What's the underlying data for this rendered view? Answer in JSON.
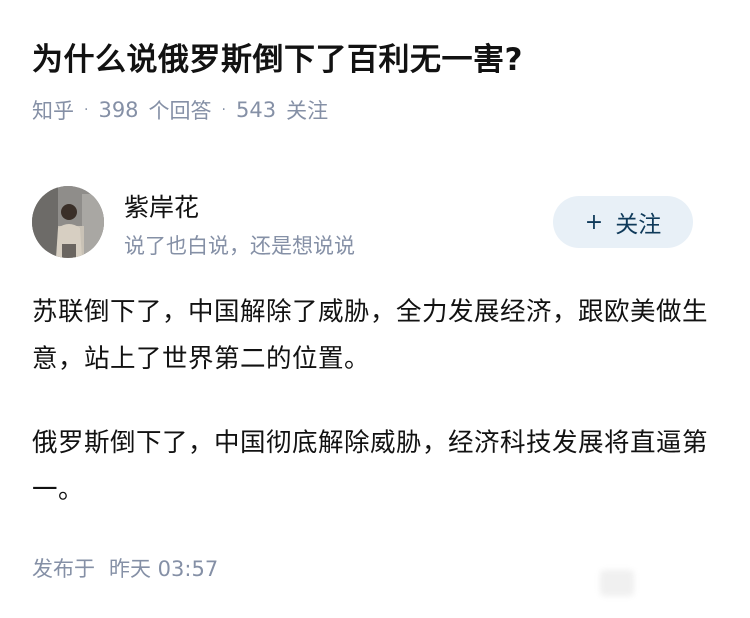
{
  "question": {
    "title": "为什么说俄罗斯倒下了百利无一害?",
    "source": "知乎",
    "answers_count": "398",
    "answers_label": "个回答",
    "followers_count": "543",
    "followers_label": "关注"
  },
  "author": {
    "name": "紫岸花",
    "bio": "说了也白说，还是想说说",
    "follow_label": "关注",
    "follow_icon": "plus-icon"
  },
  "answer": {
    "paragraphs": [
      "苏联倒下了，中国解除了威胁，全力发展经济，跟欧美做生意，站上了世界第二的位置。",
      "俄罗斯倒下了，中国彻底解除威胁，经济科技发展将直逼第一。"
    ],
    "published_label": "发布于",
    "published_time": "昨天 03:57"
  }
}
